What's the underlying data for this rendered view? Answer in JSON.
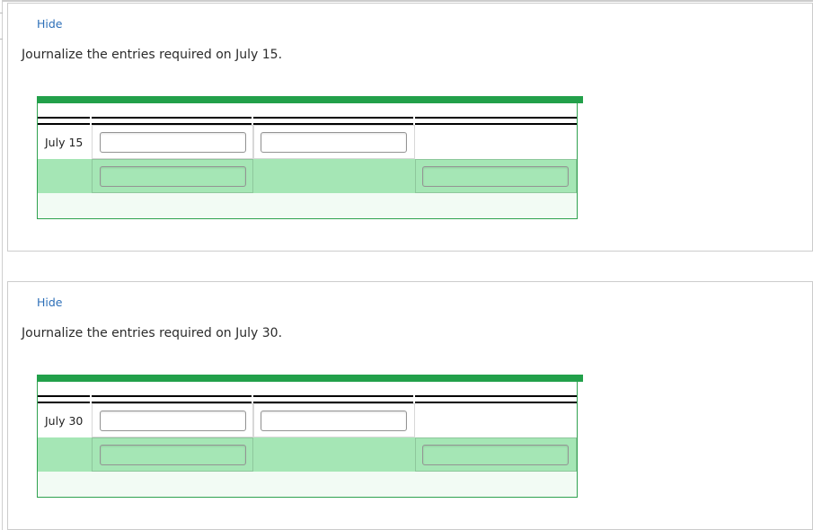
{
  "page": {
    "sections": [
      {
        "hide_label": "Hide",
        "prompt": "Journalize the entries required on July 15.",
        "journal": {
          "rows": [
            {
              "date": "July 15",
              "account_value": "",
              "account_placeholder": "",
              "description_value": "",
              "description_placeholder": "",
              "amount_value": "",
              "amount_placeholder": ""
            },
            {
              "date": "",
              "account_value": "",
              "account_placeholder": "",
              "description_value": "",
              "description_placeholder": "",
              "amount_value": "",
              "amount_placeholder": ""
            }
          ]
        }
      },
      {
        "hide_label": "Hide",
        "prompt": "Journalize the entries required on July 30.",
        "journal": {
          "rows": [
            {
              "date": "July 30",
              "account_value": "",
              "account_placeholder": "",
              "description_value": "",
              "description_placeholder": "",
              "amount_value": "",
              "amount_placeholder": ""
            },
            {
              "date": "",
              "account_value": "",
              "account_placeholder": "",
              "description_value": "",
              "description_placeholder": "",
              "amount_value": "",
              "amount_placeholder": ""
            }
          ]
        }
      }
    ],
    "colors": {
      "accent_green": "#22a04a",
      "row_green": "#a5e6b5",
      "row_pale_green": "#f2fbf4",
      "link_blue": "#2d6fb8",
      "panel_border": "#cccccc"
    }
  }
}
